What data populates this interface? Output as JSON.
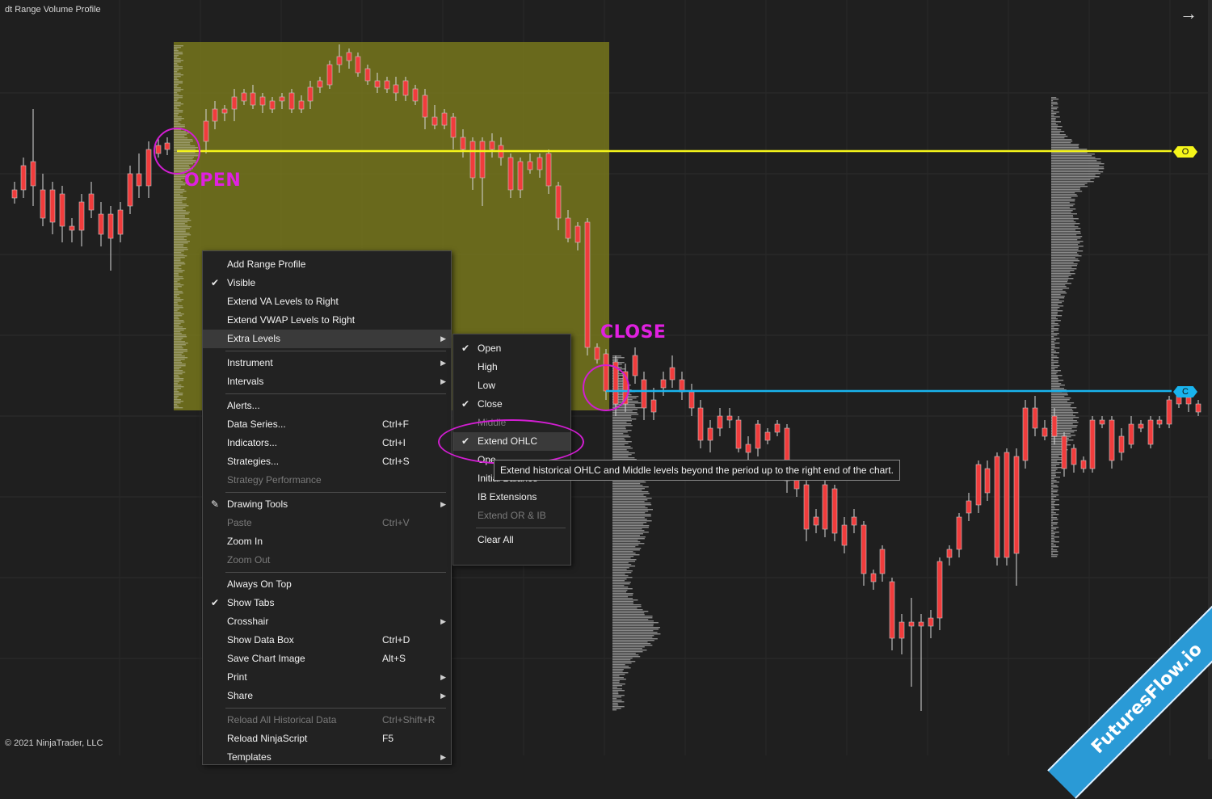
{
  "window": {
    "title": "dt Range Volume Profile",
    "copyright": "© 2021 NinjaTrader, LLC"
  },
  "annotations": {
    "open": "OPEN",
    "close": "CLOSE"
  },
  "levels": {
    "open": {
      "tag": "O",
      "color": "#f5f51a"
    },
    "close": {
      "tag": "C",
      "color": "#19b4ee"
    }
  },
  "colors": {
    "up_candle": "#5fd35f",
    "down_candle": "#f03c3c",
    "range_box": "#7a7a1c",
    "annotation": "#e020e0"
  },
  "context_menu": {
    "items": [
      {
        "label": "Add Range Profile",
        "checked": false,
        "shortcut": "",
        "submenu": false,
        "disabled": false
      },
      {
        "label": "Visible",
        "checked": true,
        "shortcut": "",
        "submenu": false,
        "disabled": false
      },
      {
        "label": "Extend VA Levels to Right",
        "checked": false,
        "shortcut": "",
        "submenu": false,
        "disabled": false
      },
      {
        "label": "Extend VWAP Levels to Right",
        "checked": false,
        "shortcut": "",
        "submenu": false,
        "disabled": false
      },
      {
        "label": "Extra Levels",
        "checked": false,
        "shortcut": "",
        "submenu": true,
        "disabled": false,
        "highlighted": true
      },
      {
        "separator": true
      },
      {
        "label": "Instrument",
        "checked": false,
        "shortcut": "",
        "submenu": true,
        "disabled": false
      },
      {
        "label": "Intervals",
        "checked": false,
        "shortcut": "",
        "submenu": true,
        "disabled": false
      },
      {
        "separator": true
      },
      {
        "label": "Alerts...",
        "checked": false,
        "shortcut": "",
        "submenu": false,
        "disabled": false
      },
      {
        "label": "Data Series...",
        "checked": false,
        "shortcut": "Ctrl+F",
        "submenu": false,
        "disabled": false
      },
      {
        "label": "Indicators...",
        "checked": false,
        "shortcut": "Ctrl+I",
        "submenu": false,
        "disabled": false
      },
      {
        "label": "Strategies...",
        "checked": false,
        "shortcut": "Ctrl+S",
        "submenu": false,
        "disabled": false
      },
      {
        "label": "Strategy Performance",
        "checked": false,
        "shortcut": "",
        "submenu": false,
        "disabled": true
      },
      {
        "separator": true
      },
      {
        "label": "Drawing Tools",
        "checked": false,
        "shortcut": "",
        "submenu": true,
        "disabled": false,
        "icon": "pencil-icon"
      },
      {
        "label": "Paste",
        "checked": false,
        "shortcut": "Ctrl+V",
        "submenu": false,
        "disabled": true
      },
      {
        "label": "Zoom In",
        "checked": false,
        "shortcut": "",
        "submenu": false,
        "disabled": false
      },
      {
        "label": "Zoom Out",
        "checked": false,
        "shortcut": "",
        "submenu": false,
        "disabled": true
      },
      {
        "separator": true
      },
      {
        "label": "Always On Top",
        "checked": false,
        "shortcut": "",
        "submenu": false,
        "disabled": false
      },
      {
        "label": "Show Tabs",
        "checked": true,
        "shortcut": "",
        "submenu": false,
        "disabled": false
      },
      {
        "label": "Crosshair",
        "checked": false,
        "shortcut": "",
        "submenu": true,
        "disabled": false
      },
      {
        "label": "Show Data Box",
        "checked": false,
        "shortcut": "Ctrl+D",
        "submenu": false,
        "disabled": false
      },
      {
        "label": "Save Chart Image",
        "checked": false,
        "shortcut": "Alt+S",
        "submenu": false,
        "disabled": false
      },
      {
        "label": "Print",
        "checked": false,
        "shortcut": "",
        "submenu": true,
        "disabled": false
      },
      {
        "label": "Share",
        "checked": false,
        "shortcut": "",
        "submenu": true,
        "disabled": false
      },
      {
        "separator": true
      },
      {
        "label": "Reload All Historical Data",
        "checked": false,
        "shortcut": "Ctrl+Shift+R",
        "submenu": false,
        "disabled": true
      },
      {
        "label": "Reload NinjaScript",
        "checked": false,
        "shortcut": "F5",
        "submenu": false,
        "disabled": false
      },
      {
        "label": "Templates",
        "checked": false,
        "shortcut": "",
        "submenu": true,
        "disabled": false
      }
    ]
  },
  "submenu": {
    "items": [
      {
        "label": "Open",
        "checked": true,
        "disabled": false
      },
      {
        "label": "High",
        "checked": false,
        "disabled": false
      },
      {
        "label": "Low",
        "checked": false,
        "disabled": false
      },
      {
        "label": "Close",
        "checked": true,
        "disabled": false
      },
      {
        "label": "Middle",
        "checked": false,
        "disabled": true
      },
      {
        "label": "Extend OHLC",
        "checked": true,
        "disabled": false,
        "highlighted": true
      },
      {
        "label": "Ope",
        "checked": false,
        "disabled": false
      },
      {
        "label": "Initial Balance",
        "checked": false,
        "disabled": false
      },
      {
        "label": "IB Extensions",
        "checked": false,
        "disabled": false
      },
      {
        "label": "Extend OR & IB",
        "checked": false,
        "disabled": true
      },
      {
        "separator": true
      },
      {
        "label": "Clear All",
        "checked": false,
        "disabled": false
      }
    ]
  },
  "tooltip": "Extend historical OHLC and Middle levels beyond the period up to the right end of the chart.",
  "watermark": "FuturesFlow.io"
}
